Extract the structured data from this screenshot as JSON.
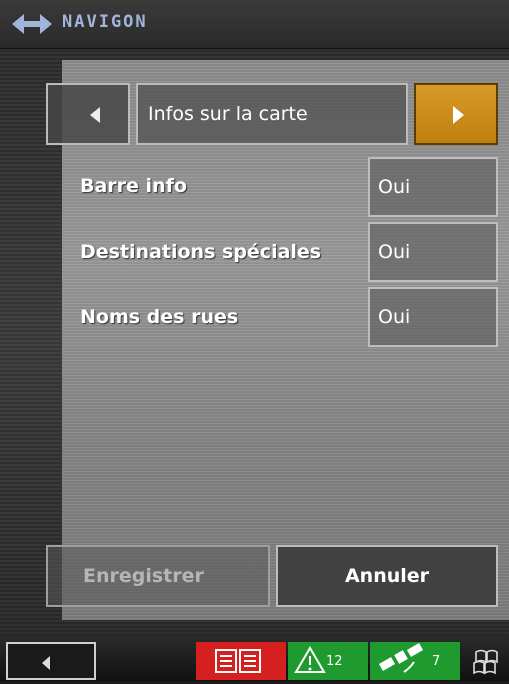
{
  "header": {
    "brand": "NAVIGON"
  },
  "nav": {
    "title": "Infos sur la carte"
  },
  "settings": [
    {
      "label": "Barre info",
      "value": "Oui"
    },
    {
      "label": "Destinations spéciales",
      "value": "Oui"
    },
    {
      "label": "Noms des rues",
      "value": "Oui"
    }
  ],
  "buttons": {
    "save": "Enregistrer",
    "cancel": "Annuler"
  },
  "taskbar": {
    "warnings_count": "12",
    "satellites_count": "7"
  },
  "colors": {
    "accent": "#c98b1a",
    "alert_red": "#d6201f",
    "status_green": "#1e9a2e"
  }
}
